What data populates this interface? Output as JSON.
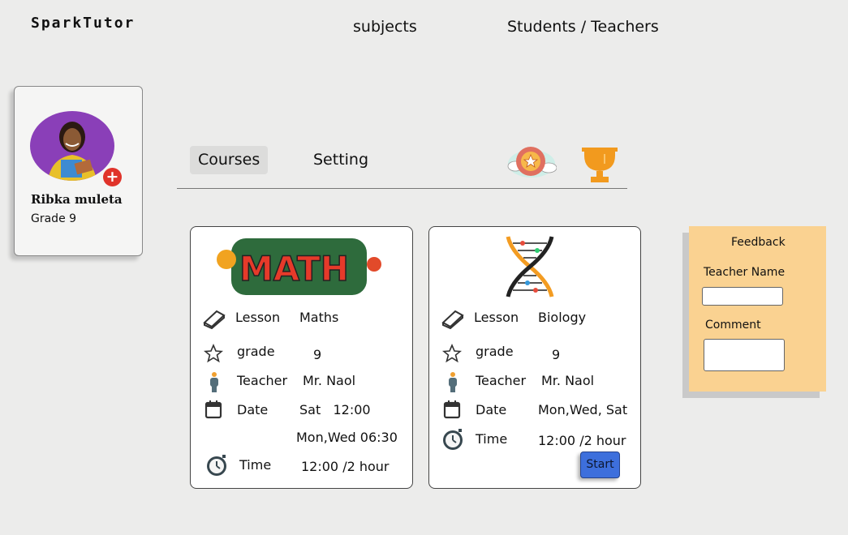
{
  "brand": {
    "name": "SparkTutor"
  },
  "nav": {
    "subjects": "subjects",
    "students_teachers": "Students / Teachers"
  },
  "profile": {
    "name": "Ribka muleta",
    "grade": "Grade 9"
  },
  "tabs": {
    "courses": "Courses",
    "setting": "Setting"
  },
  "courses": [
    {
      "banner_text": "MATH",
      "lesson_label": "Lesson",
      "lesson": "Maths",
      "grade_label": "grade",
      "grade": "9",
      "teacher_label": "Teacher",
      "teacher": "Mr. Naol",
      "date_label": "Date",
      "date": "Sat   12:00",
      "date2": "Mon,Wed 06:30",
      "time_label": "Time",
      "time": "12:00 /2 hour"
    },
    {
      "lesson_label": "Lesson",
      "lesson": "Biology",
      "grade_label": "grade",
      "grade": "9",
      "teacher_label": "Teacher",
      "teacher": "Mr. Naol",
      "date_label": "Date",
      "date": "Mon,Wed, Sat",
      "time_label": "Time",
      "time": "12:00 /2 hour",
      "start_label": "Start"
    }
  ],
  "feedback": {
    "title": "Feedback",
    "teacher_name_label": "Teacher Name",
    "comment_label": "Comment"
  },
  "colors": {
    "accent": "#3d6fdc",
    "feedback_bg": "#fad291",
    "avatar_bg": "#8a3fb8",
    "badge": "#e0332a"
  }
}
